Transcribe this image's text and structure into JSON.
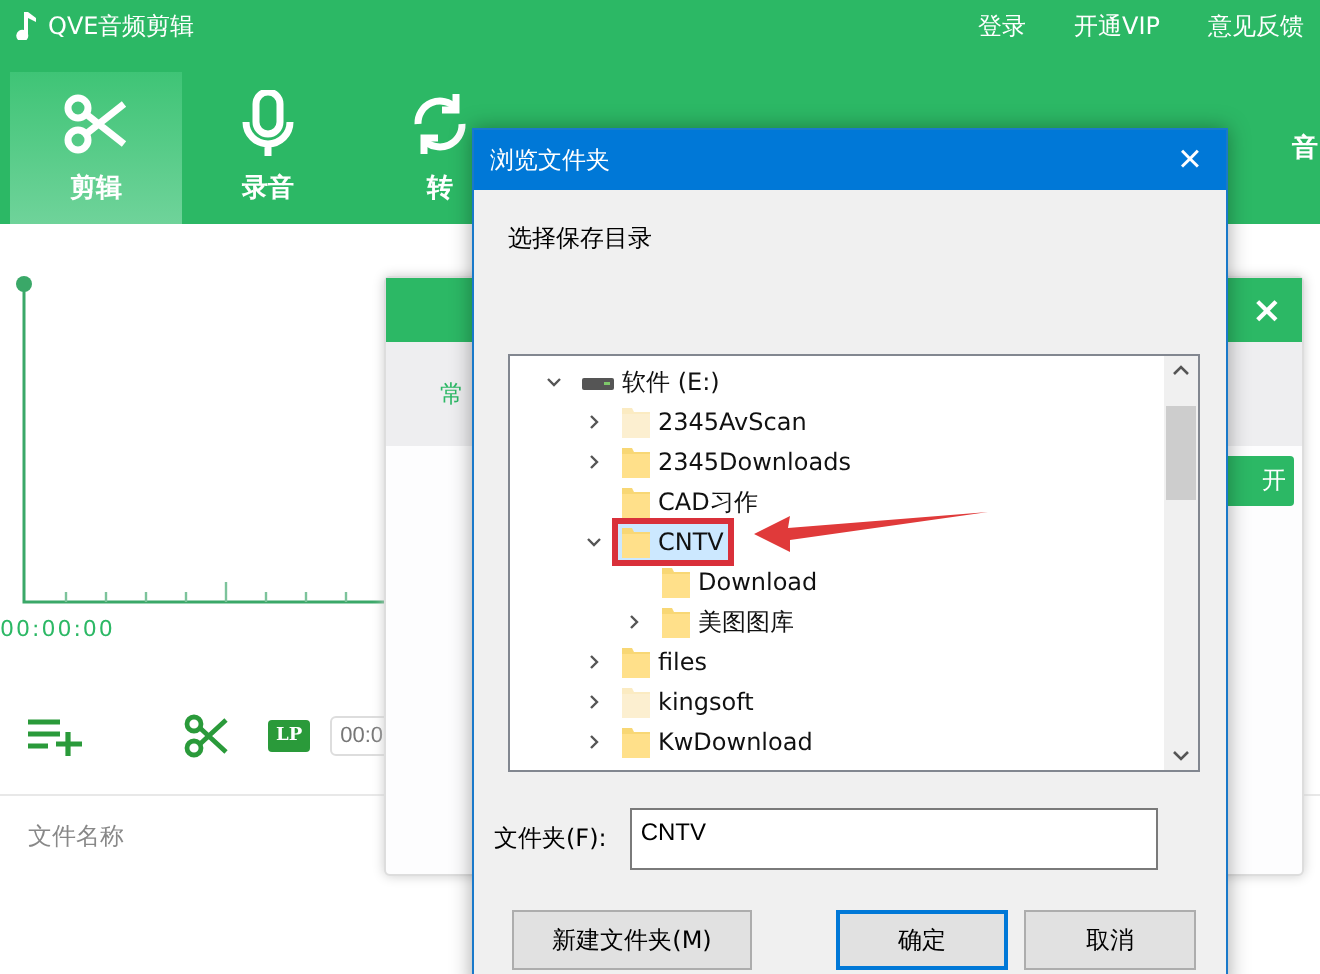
{
  "app": {
    "title": "QVE音频剪辑",
    "header_links": [
      "登录",
      "开通VIP",
      "意见反馈"
    ],
    "tabs": [
      {
        "label": "剪辑",
        "selected": true
      },
      {
        "label": "录音",
        "selected": false
      },
      {
        "label": "转",
        "selected": false
      },
      {
        "label": "音",
        "selected": false
      }
    ],
    "timeline": {
      "time": "00:00:00"
    },
    "controls": {
      "lp_badge": "LP",
      "time_value": "00:0"
    },
    "list_header": "文件名称",
    "back_panel": {
      "close": "×",
      "tab_text": "常",
      "button_text": "开"
    }
  },
  "dialog": {
    "title": "浏览文件夹",
    "close": "×",
    "prompt": "选择保存目录",
    "tree": [
      {
        "label": "软件 (E:)",
        "kind": "drive",
        "expanded": true,
        "selected": false,
        "children": [
          {
            "label": "2345AvScan",
            "kind": "folder",
            "faded": true,
            "expanded": false,
            "selected": false
          },
          {
            "label": "2345Downloads",
            "kind": "folder",
            "faded": false,
            "expanded": false,
            "selected": false
          },
          {
            "label": "CAD习作",
            "kind": "folder",
            "faded": false,
            "selected": false
          },
          {
            "label": "CNTV",
            "kind": "folder",
            "faded": false,
            "expanded": true,
            "selected": true,
            "highlighted": true,
            "children": [
              {
                "label": "Download",
                "kind": "folder",
                "faded": false,
                "selected": false
              },
              {
                "label": "美图图库",
                "kind": "folder",
                "faded": false,
                "expanded": false,
                "selected": false
              }
            ]
          },
          {
            "label": "files",
            "kind": "folder",
            "faded": false,
            "expanded": false,
            "selected": false
          },
          {
            "label": "kingsoft",
            "kind": "folder",
            "faded": true,
            "expanded": false,
            "selected": false
          },
          {
            "label": "KwDownload",
            "kind": "folder",
            "faded": false,
            "expanded": false,
            "selected": false
          }
        ]
      }
    ],
    "folder_label": "文件夹(F):",
    "folder_value": "CNTV",
    "buttons": [
      {
        "label": "新建文件夹(M)",
        "default": false
      },
      {
        "label": "确定",
        "default": true
      },
      {
        "label": "取消",
        "default": false
      }
    ]
  }
}
